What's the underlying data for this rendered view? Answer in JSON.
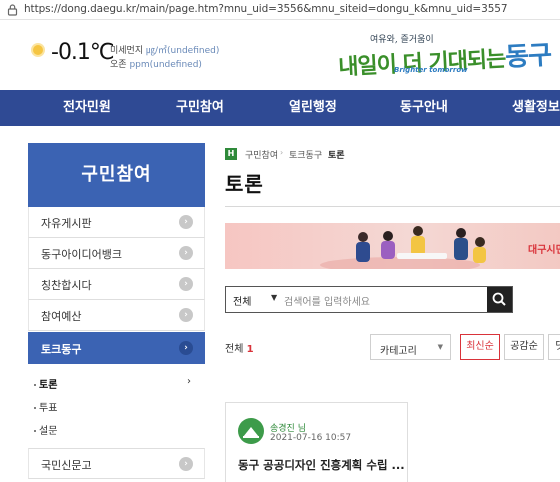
{
  "browser": {
    "url": "https://dong.daegu.kr/main/page.htm?mnu_uid=3556&mnu_siteid=dongu_k&mnu_uid=3557"
  },
  "weather": {
    "icon": "sun-icon",
    "temperature": "-0.1℃",
    "fine_dust_label": "미세먼지",
    "fine_dust_value": "㎍/㎥(undefined)",
    "ozone_label": "오존",
    "ozone_value": "ppm(undefined)"
  },
  "logo": {
    "top_text": "여유와, 즐거움이",
    "main_text_a": "내일이 더 기대되는",
    "main_text_b": "동구",
    "tagline": "Brighter tomorrow"
  },
  "nav": {
    "items": [
      "전자민원",
      "구민참여",
      "열린행정",
      "동구안내",
      "생활정보"
    ]
  },
  "sidebar": {
    "title": "구민참여",
    "items": [
      {
        "label": "자유게시판"
      },
      {
        "label": "동구아이디어뱅크"
      },
      {
        "label": "칭찬합시다"
      },
      {
        "label": "참여예산"
      },
      {
        "label": "토크동구"
      }
    ],
    "subitems": [
      {
        "label": "토론"
      },
      {
        "label": "투표"
      },
      {
        "label": "설문"
      }
    ],
    "last_item": {
      "label": "국민신문고"
    }
  },
  "breadcrumb": {
    "home_icon": "H",
    "items": [
      "구민참여",
      "토크동구",
      "토론"
    ]
  },
  "page": {
    "title": "토론",
    "banner_text": "대구시민"
  },
  "search": {
    "scope": "전체",
    "placeholder": "검색어를 입력하세요"
  },
  "list": {
    "total_label": "전체",
    "total_count": "1",
    "category_label": "카테고리",
    "sort_options": [
      "최신순",
      "공감순",
      "댓"
    ]
  },
  "card": {
    "author": "송경진 님",
    "date": "2021-07-16 10:57",
    "title": "동구 공공디자인 진흥계획 수립 ..."
  },
  "colors": {
    "nav_bg": "#2f4a94",
    "sidebar_active": "#3b63b3",
    "accent_red": "#d9333a",
    "accent_green": "#2f8a3a"
  }
}
